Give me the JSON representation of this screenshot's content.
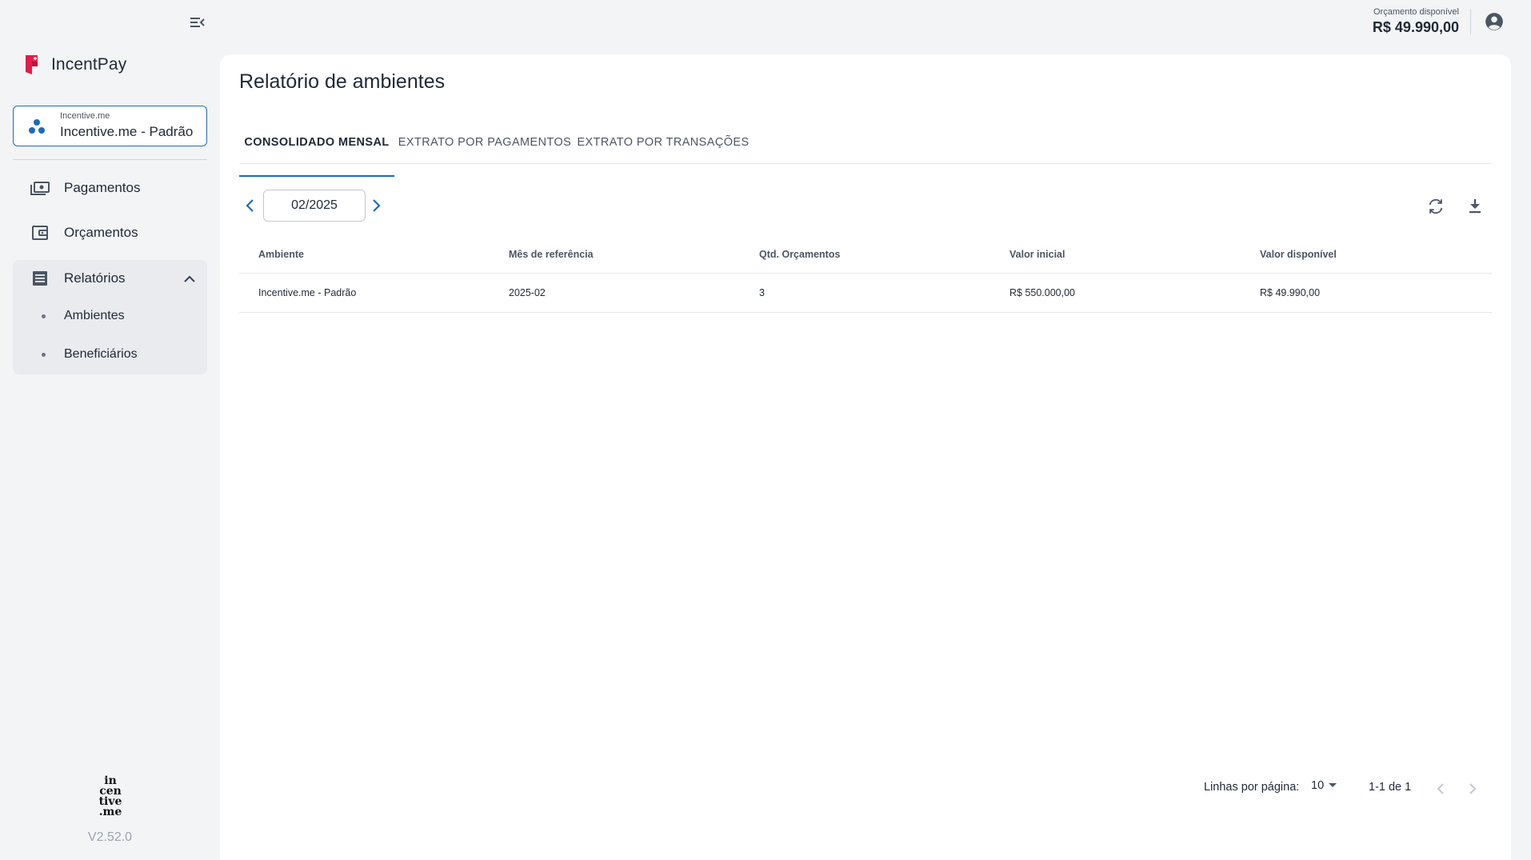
{
  "app": {
    "name": "IncentPay",
    "version": "V2.52.0",
    "footer_logo_lines": [
      "in",
      "cen",
      "tive",
      ".me"
    ]
  },
  "environment": {
    "label": "Incentive.me",
    "name": "Incentive.me - Padrão"
  },
  "sidebar": {
    "items": [
      {
        "label": "Pagamentos",
        "icon": "payments-icon"
      },
      {
        "label": "Orçamentos",
        "icon": "wallet-icon"
      },
      {
        "label": "Relatórios",
        "icon": "report-icon",
        "expanded": true,
        "children": [
          {
            "label": "Ambientes"
          },
          {
            "label": "Beneficiários"
          }
        ]
      }
    ]
  },
  "header": {
    "budget_label": "Orçamento disponível",
    "budget_value": "R$ 49.990,00"
  },
  "page": {
    "title": "Relatório de ambientes",
    "tabs": [
      {
        "label": "CONSOLIDADO MENSAL",
        "active": true
      },
      {
        "label": "EXTRATO POR PAGAMENTOS",
        "active": false
      },
      {
        "label": "EXTRATO POR TRANSAÇÕES",
        "active": false
      }
    ],
    "month": "02/2025"
  },
  "table": {
    "columns": [
      "Ambiente",
      "Mês de referência",
      "Qtd. Orçamentos",
      "Valor inicial",
      "Valor disponível"
    ],
    "rows": [
      [
        "Incentive.me - Padrão",
        "2025-02",
        "3",
        "R$ 550.000,00",
        "R$ 49.990,00"
      ]
    ]
  },
  "pagination": {
    "rows_label": "Linhas por página:",
    "rows_per_page": "10",
    "range": "1-1 de 1"
  },
  "colors": {
    "accent": "#1e6bb8",
    "brand": "#e11d48",
    "background": "#f3f4f6"
  }
}
